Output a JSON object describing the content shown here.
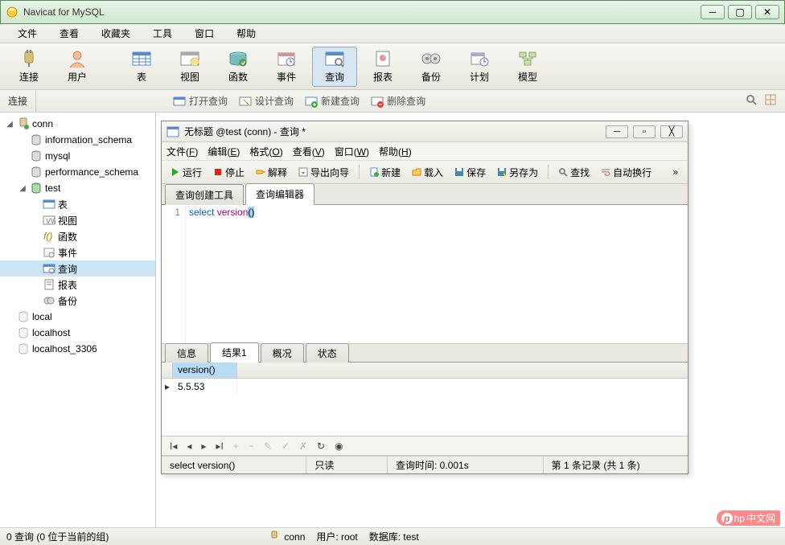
{
  "window": {
    "title": "Navicat for MySQL"
  },
  "menubar": [
    "文件",
    "查看",
    "收藏夹",
    "工具",
    "窗口",
    "帮助"
  ],
  "toolbar": {
    "groups": [
      [
        "连接",
        "用户"
      ],
      [
        "表",
        "视图",
        "函数",
        "事件",
        "查询",
        "报表",
        "备份",
        "计划",
        "模型"
      ]
    ],
    "active_index": 4
  },
  "sub_toolbar": {
    "label": "连接",
    "actions": [
      "打开查询",
      "设计查询",
      "新建查询",
      "删除查询"
    ],
    "right_icons": [
      "search-icon",
      "grid-icon"
    ]
  },
  "tree": [
    {
      "level": 0,
      "expand": "open",
      "icon": "db-conn",
      "label": "conn"
    },
    {
      "level": 1,
      "expand": "",
      "icon": "db",
      "label": "information_schema"
    },
    {
      "level": 1,
      "expand": "",
      "icon": "db",
      "label": "mysql"
    },
    {
      "level": 1,
      "expand": "",
      "icon": "db",
      "label": "performance_schema"
    },
    {
      "level": 1,
      "expand": "open",
      "icon": "db-active",
      "label": "test"
    },
    {
      "level": 2,
      "expand": "",
      "icon": "table",
      "label": "表"
    },
    {
      "level": 2,
      "expand": "",
      "icon": "view",
      "label": "视图"
    },
    {
      "level": 2,
      "expand": "",
      "icon": "func",
      "label": "函数"
    },
    {
      "level": 2,
      "expand": "",
      "icon": "event",
      "label": "事件"
    },
    {
      "level": 2,
      "expand": "",
      "icon": "query",
      "label": "查询",
      "selected": true
    },
    {
      "level": 2,
      "expand": "",
      "icon": "report",
      "label": "报表"
    },
    {
      "level": 2,
      "expand": "",
      "icon": "backup",
      "label": "备份"
    },
    {
      "level": 0,
      "expand": "",
      "icon": "db-off",
      "label": "local"
    },
    {
      "level": 0,
      "expand": "",
      "icon": "db-off",
      "label": "localhost"
    },
    {
      "level": 0,
      "expand": "",
      "icon": "db-off",
      "label": "localhost_3306"
    }
  ],
  "inner": {
    "title": "无标题 @test (conn) - 查询 *",
    "menubar": [
      {
        "text": "文件",
        "key": "F"
      },
      {
        "text": "编辑",
        "key": "E"
      },
      {
        "text": "格式",
        "key": "O"
      },
      {
        "text": "查看",
        "key": "V"
      },
      {
        "text": "窗口",
        "key": "W"
      },
      {
        "text": "帮助",
        "key": "H"
      }
    ],
    "toolbar": [
      "运行",
      "停止",
      "解释",
      "导出向导",
      "|",
      "新建",
      "载入",
      "保存",
      "另存为",
      "|",
      "查找",
      "自动换行"
    ],
    "editor_tabs": [
      "查询创建工具",
      "查询编辑器"
    ],
    "editor_active_tab": 1,
    "editor": {
      "line_no": "1",
      "code_kw": "select",
      "code_fn": "version",
      "code_paren": "()"
    },
    "result_tabs": [
      "信息",
      "结果1",
      "概况",
      "状态"
    ],
    "result_active_tab": 1,
    "grid": {
      "header": "version()",
      "row_value": "5.5.53"
    },
    "status": {
      "sql": "select version()",
      "readonly": "只读",
      "query_time": "查询时间: 0.001s",
      "record": "第 1 条记录 (共 1 条)"
    }
  },
  "main_status": {
    "left": "0 查询 (0 位于当前的组)",
    "conn_icon_label": "conn",
    "user": "用户: root",
    "db": "数据库: test"
  },
  "watermark": "中文网"
}
